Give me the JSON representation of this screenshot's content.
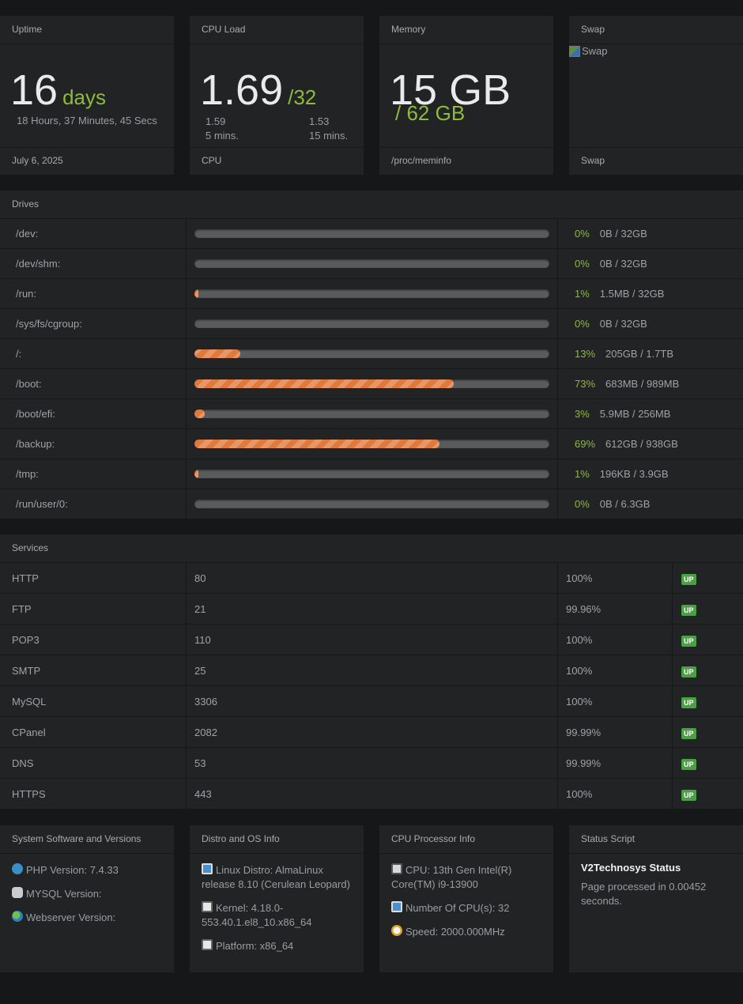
{
  "uptime": {
    "title": "Uptime",
    "value": "16",
    "unit": "days",
    "detail": "18 Hours, 37 Minutes, 45 Secs",
    "footer": "July 6, 2025"
  },
  "cpu": {
    "title": "CPU Load",
    "value": "1.69",
    "unit": "/32",
    "load5_value": "1.59",
    "load5_label": "5 mins.",
    "load15_value": "1.53",
    "load15_label": "15 mins.",
    "footer": "CPU"
  },
  "memory": {
    "title": "Memory",
    "value": "15 GB",
    "total": "/ 62 GB",
    "footer": "/proc/meminfo"
  },
  "swap": {
    "title": "Swap",
    "img_alt": "Swap",
    "footer": "Swap"
  },
  "drives": {
    "title": "Drives",
    "rows": [
      {
        "mount": "/dev:",
        "pct": "0%",
        "pct_value": 0,
        "usage": "0B / 32GB"
      },
      {
        "mount": "/dev/shm:",
        "pct": "0%",
        "pct_value": 0,
        "usage": "0B / 32GB"
      },
      {
        "mount": "/run:",
        "pct": "1%",
        "pct_value": 1,
        "usage": "1.5MB / 32GB"
      },
      {
        "mount": "/sys/fs/cgroup:",
        "pct": "0%",
        "pct_value": 0,
        "usage": "0B / 32GB"
      },
      {
        "mount": "/:",
        "pct": "13%",
        "pct_value": 13,
        "usage": "205GB / 1.7TB"
      },
      {
        "mount": "/boot:",
        "pct": "73%",
        "pct_value": 73,
        "usage": "683MB / 989MB"
      },
      {
        "mount": "/boot/efi:",
        "pct": "3%",
        "pct_value": 3,
        "usage": "5.9MB / 256MB"
      },
      {
        "mount": "/backup:",
        "pct": "69%",
        "pct_value": 69,
        "usage": "612GB / 938GB"
      },
      {
        "mount": "/tmp:",
        "pct": "1%",
        "pct_value": 1,
        "usage": "196KB / 3.9GB"
      },
      {
        "mount": "/run/user/0:",
        "pct": "0%",
        "pct_value": 0,
        "usage": "0B / 6.3GB"
      }
    ]
  },
  "services": {
    "title": "Services",
    "rows": [
      {
        "name": "HTTP",
        "port": "80",
        "uptime": "100%",
        "status": "UP"
      },
      {
        "name": "FTP",
        "port": "21",
        "uptime": "99.96%",
        "status": "UP"
      },
      {
        "name": "POP3",
        "port": "110",
        "uptime": "100%",
        "status": "UP"
      },
      {
        "name": "SMTP",
        "port": "25",
        "uptime": "100%",
        "status": "UP"
      },
      {
        "name": "MySQL",
        "port": "3306",
        "uptime": "100%",
        "status": "UP"
      },
      {
        "name": "CPanel",
        "port": "2082",
        "uptime": "99.99%",
        "status": "UP"
      },
      {
        "name": "DNS",
        "port": "53",
        "uptime": "99.99%",
        "status": "UP"
      },
      {
        "name": "HTTPS",
        "port": "443",
        "uptime": "100%",
        "status": "UP"
      }
    ]
  },
  "software": {
    "title": "System Software and Versions",
    "php": "PHP Version: 7.4.33",
    "mysql": "MYSQL Version:",
    "webserver": "Webserver Version:"
  },
  "distro": {
    "title": "Distro and OS Info",
    "distro": "Linux Distro: AlmaLinux release 8.10 (Cerulean Leopard)",
    "kernel": "Kernel: 4.18.0-553.40.1.el8_10.x86_64",
    "platform": "Platform: x86_64"
  },
  "cpuinfo": {
    "title": "CPU Processor Info",
    "cpu": "CPU: 13th Gen Intel(R) Core(TM) i9-13900",
    "count": "Number Of CPU(s): 32",
    "speed": "Speed: 2000.000MHz"
  },
  "status_script": {
    "title": "Status Script",
    "name": "V2Technosys Status",
    "processed": "Page processed in 0.00452 seconds."
  },
  "colors": {
    "accent_green": "#8dbb3a",
    "bar_orange": "#e0793c",
    "badge_green": "#4aa043",
    "panel_bg": "#222325",
    "page_bg": "#161718"
  }
}
